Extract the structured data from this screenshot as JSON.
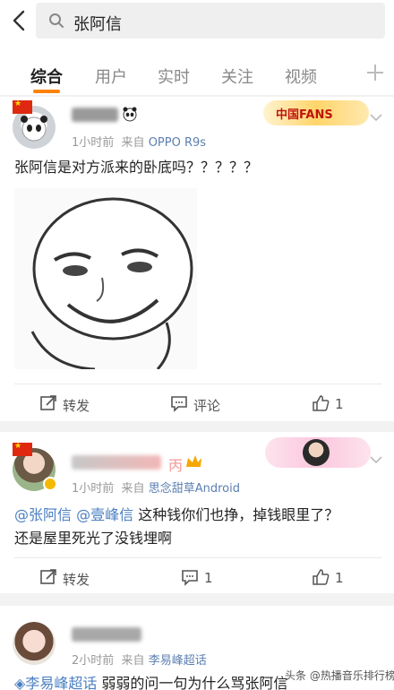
{
  "search": {
    "query": "张阿信"
  },
  "tabs": [
    {
      "label": "综合"
    },
    {
      "label": "用户"
    },
    {
      "label": "实时"
    },
    {
      "label": "关注"
    },
    {
      "label": "视频"
    }
  ],
  "post1": {
    "time": "1小时前",
    "from_label": "来自",
    "source": "OPPO R9s",
    "badge": "中国FANS",
    "text": "张阿信是对方派来的卧底吗？？？？？",
    "repost_label": "转发",
    "comment_label": "评论",
    "like_count": "1"
  },
  "post2": {
    "name_suffix": "丙",
    "time": "1小时前",
    "from_label": "来自",
    "source": "思念甜草Android",
    "mention1": "@张阿信",
    "mention2": "@壹峰信",
    "text1_rest": " 这种钱你们也挣，掉钱眼里了？",
    "text2": "还是屋里死光了没钱埋啊",
    "repost_label": "转发",
    "comment_count": "1",
    "like_count": "1"
  },
  "post3": {
    "time": "2小时前",
    "from_label": "来自",
    "source": "李易峰超话",
    "mention": "李易峰超话",
    "text_rest": " 弱弱的问一句为什么骂张阿信"
  },
  "watermark": "头条 @热播音乐排行榜"
}
